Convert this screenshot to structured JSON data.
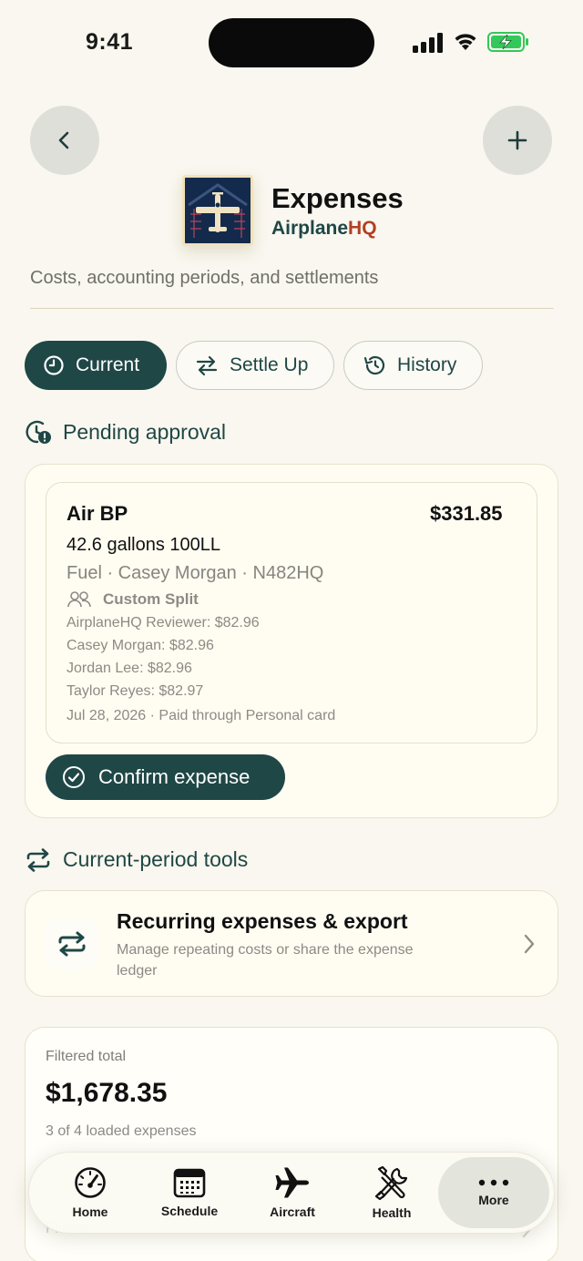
{
  "status_bar": {
    "time": "9:41"
  },
  "header": {
    "title": "Expenses",
    "brand_part1": "Airplane",
    "brand_part2": "HQ",
    "subtitle": "Costs, accounting periods, and settlements"
  },
  "tabs": [
    {
      "label": "Current",
      "active": true
    },
    {
      "label": "Settle Up",
      "active": false
    },
    {
      "label": "History",
      "active": false
    }
  ],
  "pending": {
    "heading": "Pending approval",
    "expense": {
      "vendor": "Air BP",
      "amount": "$331.85",
      "description": "42.6 gallons 100LL",
      "meta": "Fuel · Casey Morgan · N482HQ",
      "split_label": "Custom Split",
      "splits": [
        "AirplaneHQ Reviewer: $82.96",
        "Casey Morgan: $82.96",
        "Jordan Lee: $82.96",
        "Taylor Reyes: $82.97"
      ],
      "footer": "Jul 28, 2026 · Paid through Personal card"
    },
    "confirm_label": "Confirm expense"
  },
  "tools": {
    "heading": "Current-period tools",
    "title": "Recurring expenses & export",
    "subtitle": "Manage repeating costs or share the expense ledger"
  },
  "total": {
    "label": "Filtered total",
    "amount": "$1,678.35",
    "count": "3 of 4 loaded expenses",
    "next_row": "Filters"
  },
  "nav": [
    {
      "label": "Home",
      "icon": "gauge-icon"
    },
    {
      "label": "Schedule",
      "icon": "calendar-icon"
    },
    {
      "label": "Aircraft",
      "icon": "airplane-icon"
    },
    {
      "label": "Health",
      "icon": "tools-icon"
    },
    {
      "label": "More",
      "icon": "more-dots-icon",
      "active": true
    }
  ],
  "colors": {
    "background": "#f9f7ef",
    "primary": "#1f4746",
    "brand_accent": "#b23f24",
    "battery": "#34c759"
  }
}
